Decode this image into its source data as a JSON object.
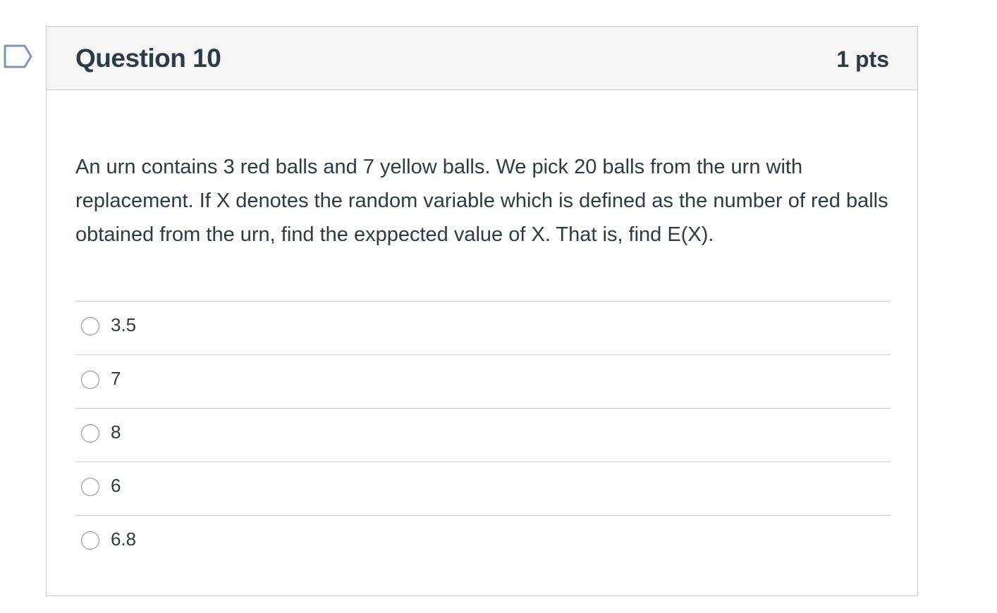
{
  "question": {
    "title": "Question 10",
    "points": "1 pts",
    "text": "An urn contains 3 red balls and 7 yellow balls.  We pick 20 balls from the urn with replacement.  If X denotes the random variable which is defined as the number of red balls obtained from the urn, find the exppected value of X. That is, find E(X).",
    "flag_icon": "bookmark-flag-icon",
    "answers": [
      {
        "label": "3.5",
        "selected": false
      },
      {
        "label": "7",
        "selected": false
      },
      {
        "label": "8",
        "selected": false
      },
      {
        "label": "6",
        "selected": false
      },
      {
        "label": "6.8",
        "selected": false
      }
    ]
  },
  "colors": {
    "text": "#2d3b45",
    "border": "#c7cdd1",
    "header_bg": "#f5f5f5",
    "flag": "#7b96b8"
  }
}
